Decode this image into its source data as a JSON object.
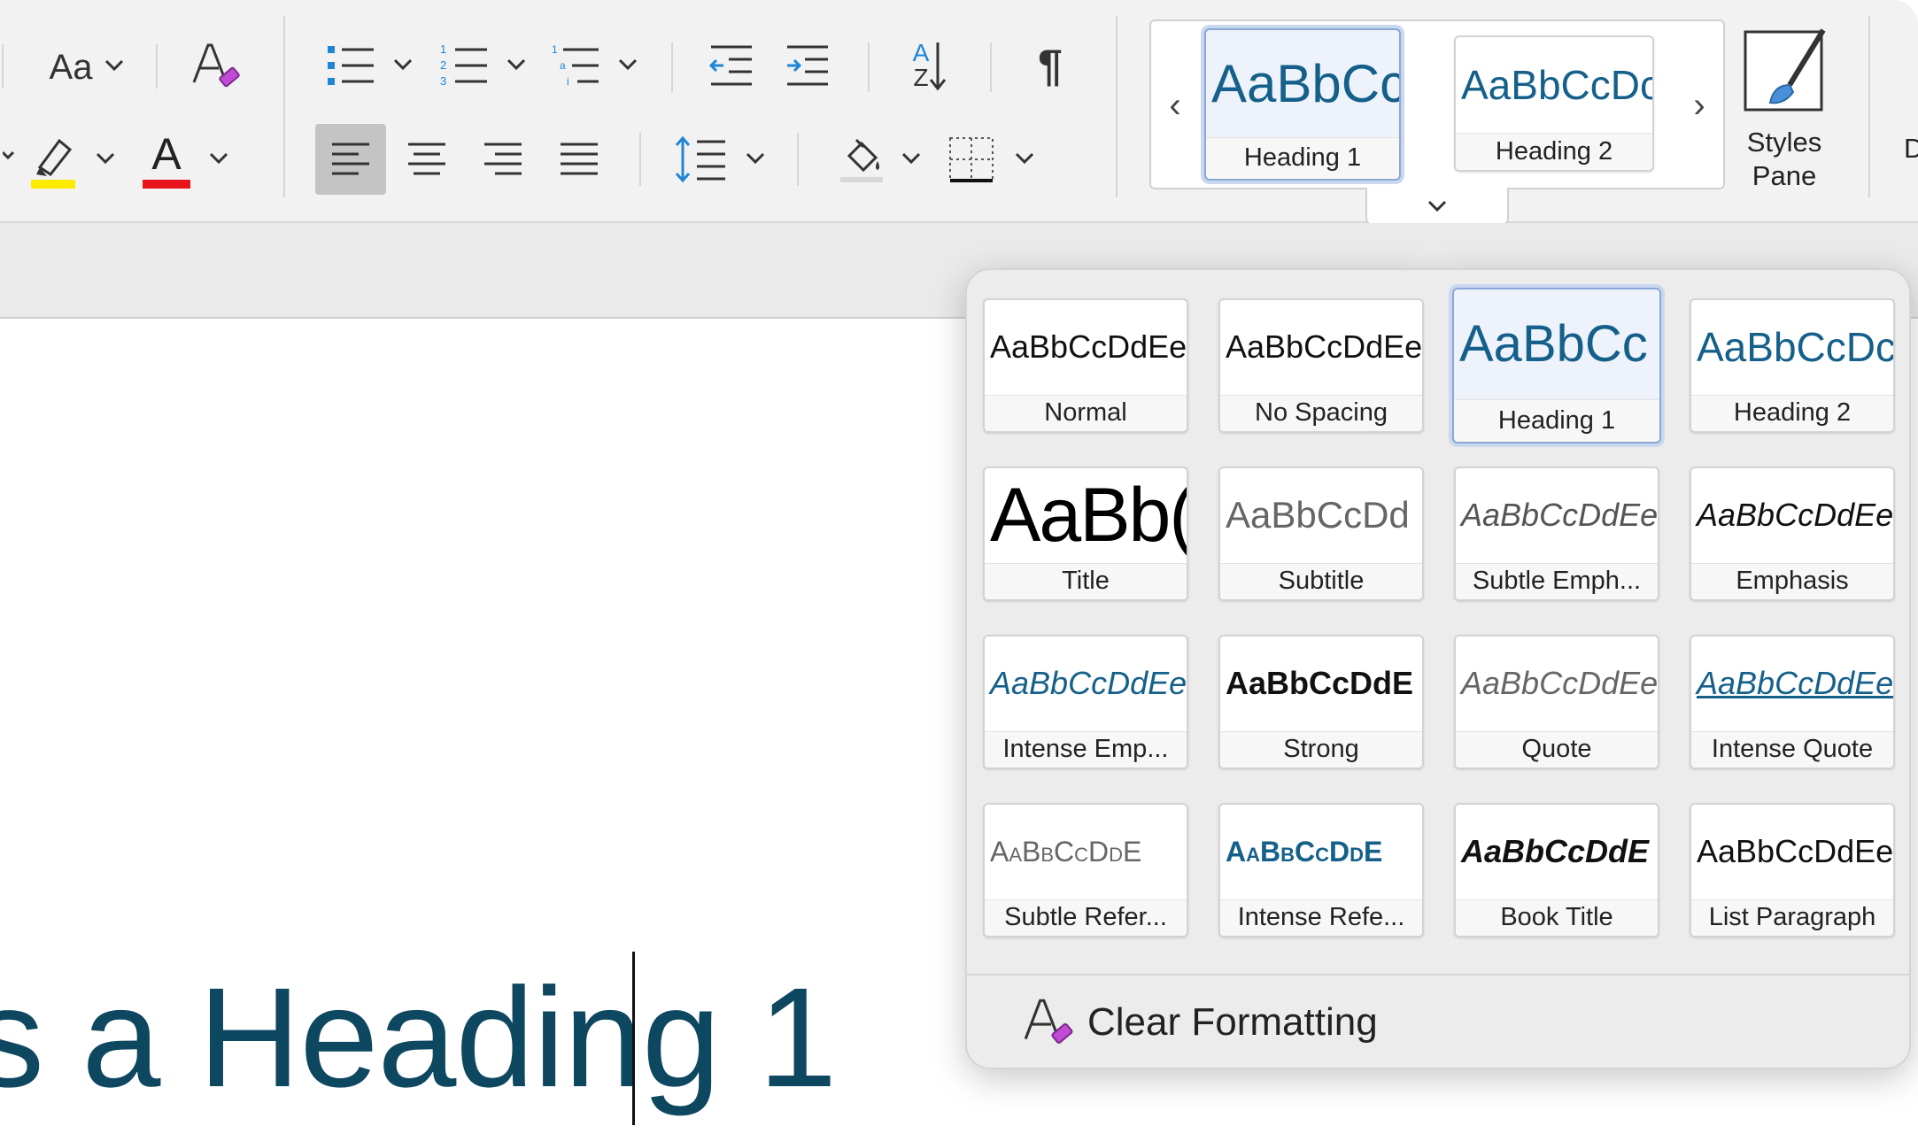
{
  "ribbon": {
    "change_case_label": "Aa",
    "pilcrow": "¶",
    "sort_label_top": "A",
    "sort_label_bottom": "Z",
    "font_color_letter": "A",
    "highlight_color": "#ffeb00",
    "font_color": "#e8141c",
    "gallery": {
      "prev_arrow": "‹",
      "next_arrow": "›",
      "styles": [
        {
          "preview": "AaBbCc",
          "name": "Heading 1",
          "selected": true
        },
        {
          "preview": "AaBbCcDc",
          "name": "Heading 2",
          "selected": false
        }
      ],
      "expand_chevron": "⌄"
    },
    "styles_pane": {
      "line1": "Styles",
      "line2": "Pane"
    },
    "partial_next": "D"
  },
  "styles_panel": {
    "tiles": [
      {
        "preview": "AaBbCcDdEe",
        "name": "Normal"
      },
      {
        "preview": "AaBbCcDdEe",
        "name": "No Spacing"
      },
      {
        "preview": "AaBbCc",
        "name": "Heading 1",
        "selected": true
      },
      {
        "preview": "AaBbCcDc",
        "name": "Heading 2"
      },
      {
        "preview": "AaBb(",
        "name": "Title"
      },
      {
        "preview": "AaBbCcDd",
        "name": "Subtitle"
      },
      {
        "preview": "AaBbCcDdEe",
        "name": "Subtle Emph..."
      },
      {
        "preview": "AaBbCcDdEe",
        "name": "Emphasis"
      },
      {
        "preview": "AaBbCcDdEe",
        "name": "Intense Emp..."
      },
      {
        "preview": "AaBbCcDdE",
        "name": "Strong"
      },
      {
        "preview": "AaBbCcDdEe",
        "name": "Quote"
      },
      {
        "preview": "AaBbCcDdEe",
        "name": "Intense Quote"
      },
      {
        "preview": "AaBbCcDdE",
        "name": "Subtle Refer..."
      },
      {
        "preview": "AaBbCcDdE",
        "name": "Intense Refe..."
      },
      {
        "preview": "AaBbCcDdE",
        "name": "Book Title"
      },
      {
        "preview": "AaBbCcDdEe",
        "name": "List Paragraph"
      }
    ],
    "clear_formatting": "Clear Formatting"
  },
  "document": {
    "text": "s a Heading 1"
  },
  "colors": {
    "heading_text": "#0e4760",
    "accent_blue": "#1f86d6",
    "selection_border": "#8aa8d6"
  }
}
